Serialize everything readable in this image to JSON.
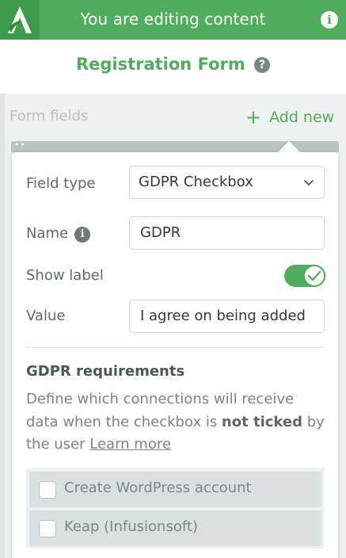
{
  "topbar": {
    "title": "You are editing content",
    "info_icon": "i"
  },
  "header": {
    "title": "Registration Form",
    "help_icon": "?"
  },
  "background": {
    "form_fields_label": "Form fields",
    "add_new_label": "Add new",
    "add_icon": "+"
  },
  "field_settings": {
    "field_type": {
      "label": "Field type",
      "value": "GDPR Checkbox"
    },
    "name": {
      "label": "Name",
      "value": "GDPR",
      "info_icon": "i"
    },
    "show_label": {
      "label": "Show label",
      "enabled": true
    },
    "value": {
      "label": "Value",
      "value": "I agree on being added"
    }
  },
  "gdpr": {
    "title": "GDPR requirements",
    "desc_start": "Define which connections will receive data when the checkbox is ",
    "desc_bold": "not ticked",
    "desc_end": " by the user ",
    "learn_more": "Learn more",
    "connections": [
      {
        "label": "Create WordPress account",
        "checked": false
      },
      {
        "label": "Keap (Infusionsoft)",
        "checked": false
      }
    ]
  },
  "colors": {
    "brand_green": "#4fad5b",
    "logo_green": "#3f9b4c",
    "text_gray": "#5f6b6b"
  }
}
